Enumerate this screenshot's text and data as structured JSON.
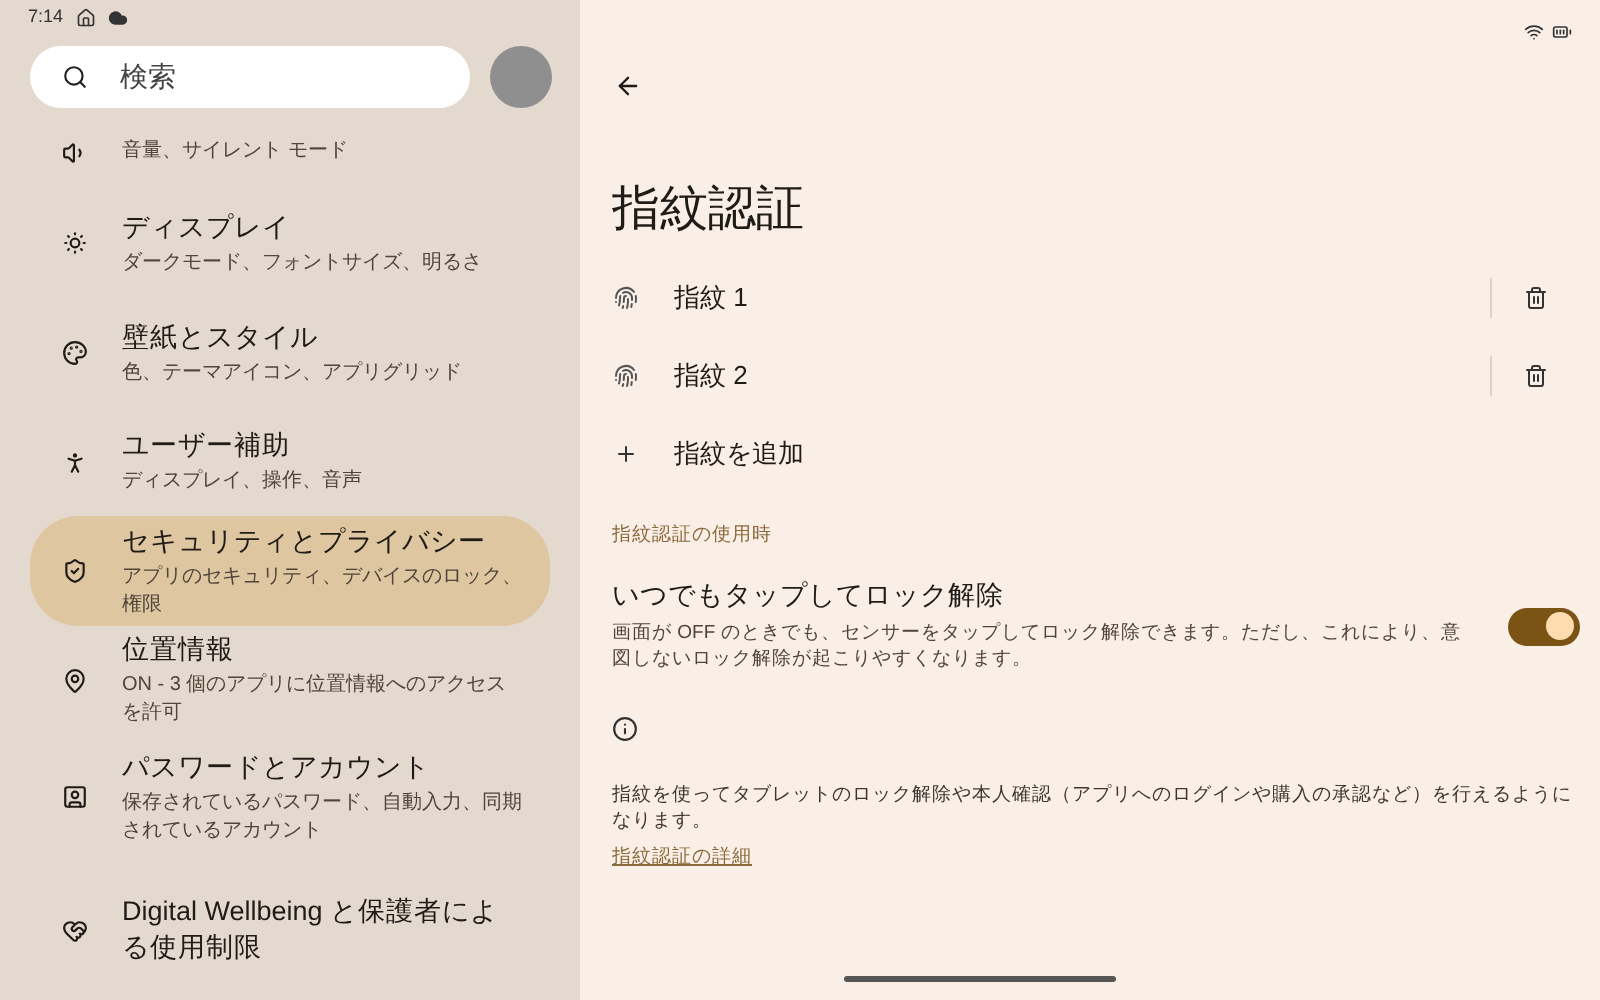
{
  "status_bar": {
    "time": "7:14"
  },
  "search": {
    "placeholder": "検索"
  },
  "sidebar": {
    "items": [
      {
        "subtitle": "音量、サイレント モード",
        "selected": false
      },
      {
        "title": "ディスプレイ",
        "subtitle": "ダークモード、フォントサイズ、明るさ",
        "selected": false
      },
      {
        "title": "壁紙とスタイル",
        "subtitle": "色、テーマアイコン、アプリグリッド",
        "selected": false
      },
      {
        "title": "ユーザー補助",
        "subtitle": "ディスプレイ、操作、音声",
        "selected": false
      },
      {
        "title": "セキュリティとプライバシー",
        "subtitle": "アプリのセキュリティ、デバイスのロック、権限",
        "selected": true
      },
      {
        "title": "位置情報",
        "subtitle": "ON - 3 個のアプリに位置情報へのアクセスを許可",
        "selected": false
      },
      {
        "title": "パスワードとアカウント",
        "subtitle": "保存されているパスワード、自動入力、同期されているアカウント",
        "selected": false
      },
      {
        "title": "Digital Wellbeing と保護者による使用制限",
        "selected": false
      }
    ]
  },
  "page": {
    "title": "指紋認証",
    "fingerprints": [
      {
        "label": "指紋 1"
      },
      {
        "label": "指紋 2"
      }
    ],
    "add_button": {
      "label": "指紋を追加"
    },
    "section_header": "指紋認証の使用時",
    "unlock_setting": {
      "title": "いつでもタップしてロック解除",
      "description": "画面が OFF のときでも、センサーをタップしてロック解除できます。ただし、これにより、意図しないロック解除が起こりやすくなります。",
      "on": true
    },
    "info_text": "指紋を使ってタブレットのロック解除や本人確認（アプリへのログインや購入の承認など）を行えるようになります。",
    "link": "指紋認証の詳細"
  }
}
